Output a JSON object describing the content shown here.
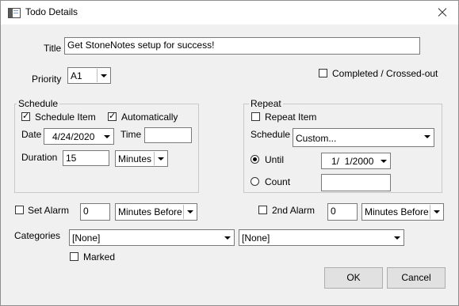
{
  "window": {
    "title": "Todo Details"
  },
  "title_field": {
    "label": "Title",
    "value": "Get StoneNotes setup for success!"
  },
  "priority": {
    "label": "Priority",
    "value": "A1"
  },
  "completed": {
    "label": "Completed / Crossed-out",
    "checked": false
  },
  "schedule": {
    "group_label": "Schedule",
    "schedule_item": {
      "label": "Schedule Item",
      "checked": true
    },
    "automatically": {
      "label": "Automatically",
      "checked": true
    },
    "date_label": "Date",
    "date_value": "4/24/2020",
    "time_label": "Time",
    "time_value": "",
    "duration_label": "Duration",
    "duration_value": "15",
    "duration_unit": "Minutes"
  },
  "repeat": {
    "group_label": "Repeat",
    "repeat_item": {
      "label": "Repeat Item",
      "checked": false
    },
    "schedule_label": "Schedule",
    "schedule_value": "Custom...",
    "until": {
      "label": "Until",
      "selected": true,
      "value": "1/  1/2000"
    },
    "count": {
      "label": "Count",
      "selected": false,
      "value": ""
    }
  },
  "alarm": {
    "label": "Set Alarm",
    "checked": false,
    "value": "0",
    "unit": "Minutes Before"
  },
  "alarm2": {
    "label": "2nd Alarm",
    "checked": false,
    "value": "0",
    "unit": "Minutes Before"
  },
  "categories": {
    "label": "Categories",
    "first": "[None]",
    "second": "[None]"
  },
  "marked": {
    "label": "Marked",
    "checked": false
  },
  "buttons": {
    "ok": "OK",
    "cancel": "Cancel"
  }
}
